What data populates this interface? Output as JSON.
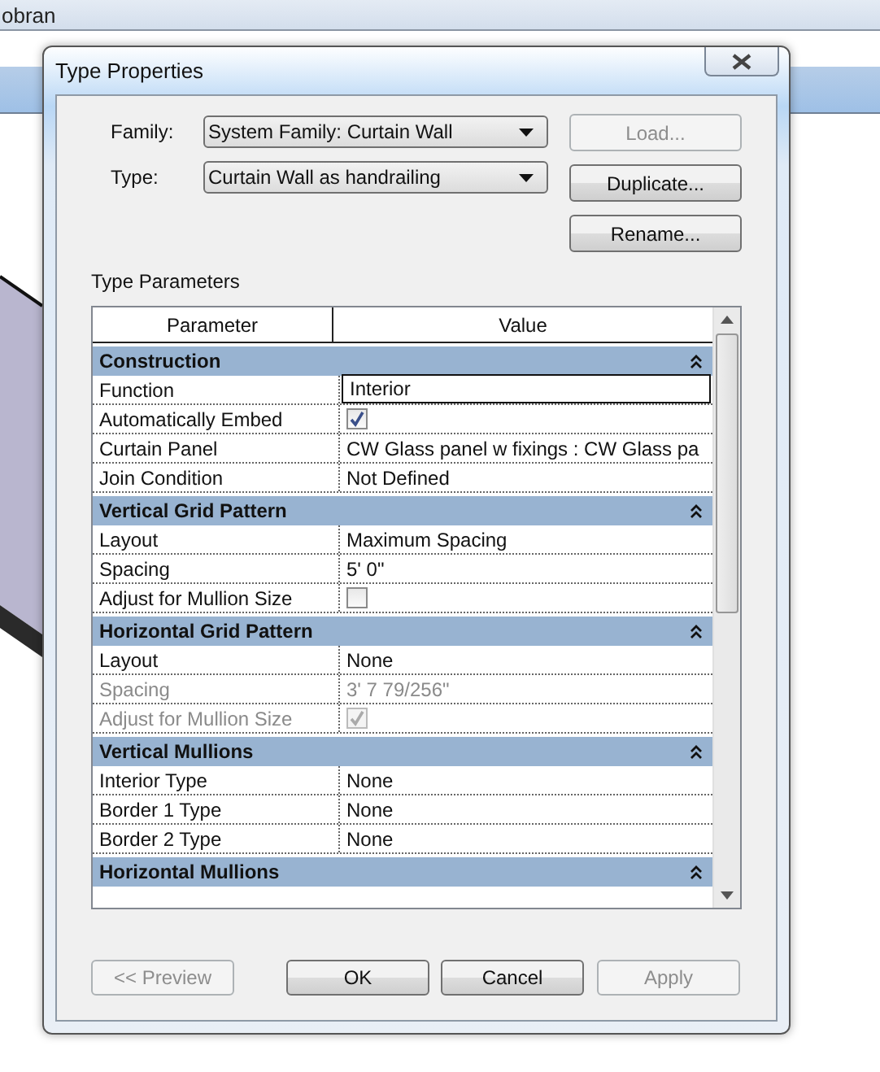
{
  "app_title": "obran",
  "dialog": {
    "title": "Type Properties"
  },
  "family": {
    "label": "Family:",
    "value": "System Family: Curtain Wall"
  },
  "type": {
    "label": "Type:",
    "value": "Curtain Wall as handrailing"
  },
  "side_buttons": [
    {
      "label": "Load...",
      "disabled": true
    },
    {
      "label": "Duplicate...",
      "disabled": false
    },
    {
      "label": "Rename...",
      "disabled": false
    }
  ],
  "section_label": "Type Parameters",
  "table": {
    "columns": [
      "Parameter",
      "Value"
    ],
    "groups": [
      {
        "name": "Construction",
        "expanded": true,
        "rows": [
          {
            "kind": "text",
            "name": "Function",
            "value": "Interior",
            "selected": true,
            "disabled": false
          },
          {
            "kind": "checkbox",
            "name": "Automatically Embed",
            "checked": true,
            "selected": false,
            "disabled": false
          },
          {
            "kind": "text",
            "name": "Curtain Panel",
            "value": "CW Glass panel w fixings : CW Glass pa",
            "selected": false,
            "disabled": false
          },
          {
            "kind": "text",
            "name": "Join Condition",
            "value": "Not Defined",
            "selected": false,
            "disabled": false
          }
        ]
      },
      {
        "name": "Vertical Grid Pattern",
        "expanded": true,
        "rows": [
          {
            "kind": "text",
            "name": "Layout",
            "value": "Maximum Spacing",
            "selected": false,
            "disabled": false
          },
          {
            "kind": "text",
            "name": "Spacing",
            "value": "5'  0\"",
            "selected": false,
            "disabled": false
          },
          {
            "kind": "checkbox",
            "name": "Adjust for Mullion Size",
            "checked": false,
            "selected": false,
            "disabled": false
          }
        ]
      },
      {
        "name": "Horizontal Grid Pattern",
        "expanded": true,
        "rows": [
          {
            "kind": "text",
            "name": "Layout",
            "value": "None",
            "selected": false,
            "disabled": false
          },
          {
            "kind": "text",
            "name": "Spacing",
            "value": "3'  7 79/256\"",
            "selected": false,
            "disabled": true
          },
          {
            "kind": "checkbox",
            "name": "Adjust for Mullion Size",
            "checked": true,
            "selected": false,
            "disabled": true
          }
        ]
      },
      {
        "name": "Vertical Mullions",
        "expanded": true,
        "rows": [
          {
            "kind": "text",
            "name": "Interior Type",
            "value": "None",
            "selected": false,
            "disabled": false
          },
          {
            "kind": "text",
            "name": "Border 1 Type",
            "value": "None",
            "selected": false,
            "disabled": false
          },
          {
            "kind": "text",
            "name": "Border 2 Type",
            "value": "None",
            "selected": false,
            "disabled": false
          }
        ]
      },
      {
        "name": "Horizontal Mullions",
        "expanded": true
      }
    ]
  },
  "bottom_buttons": [
    {
      "label": "<< Preview",
      "disabled": true
    },
    {
      "label": "OK",
      "disabled": false
    },
    {
      "label": "Cancel",
      "disabled": false
    },
    {
      "label": "Apply",
      "disabled": true
    }
  ]
}
